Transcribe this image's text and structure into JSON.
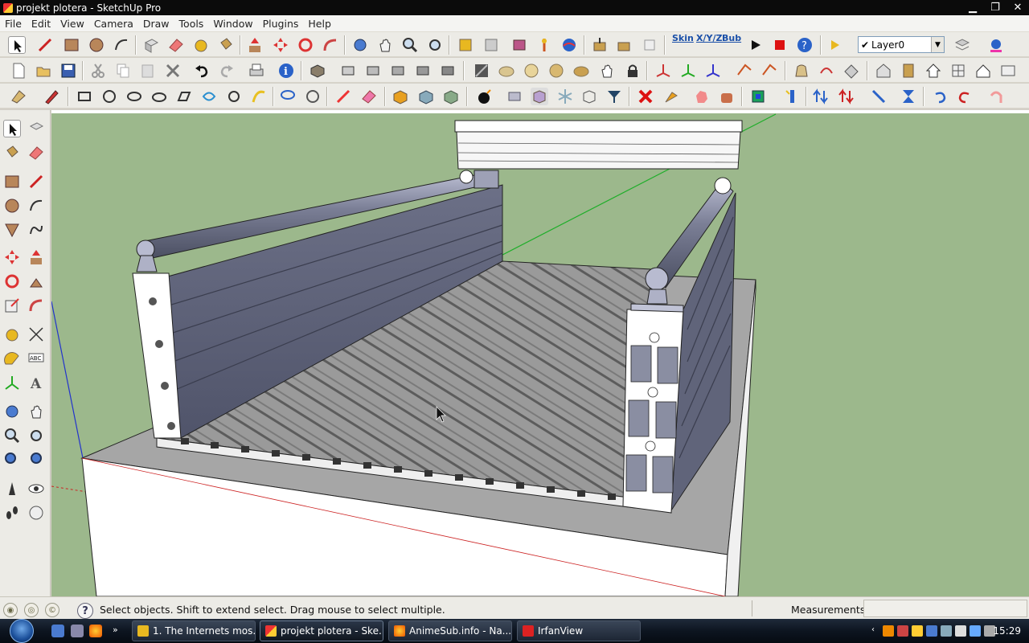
{
  "window": {
    "title": "projekt plotera - SketchUp Pro"
  },
  "menu": [
    "File",
    "Edit",
    "View",
    "Camera",
    "Draw",
    "Tools",
    "Window",
    "Plugins",
    "Help"
  ],
  "toolbar": {
    "skin_label": "Skin",
    "xyz_label": "X/Y/Z",
    "bub_label": "Bub",
    "layer_value": "Layer0",
    "layer_check": "✔"
  },
  "status": {
    "hint": "Select objects. Shift to extend select. Drag mouse to select multiple.",
    "measurements_label": "Measurements",
    "measurements_value": ""
  },
  "taskbar": {
    "tasks": [
      {
        "label": "1. The Internets mos..."
      },
      {
        "label": "projekt plotera - Ske..."
      },
      {
        "label": "AnimeSub.info - Na..."
      },
      {
        "label": "IrfanView"
      }
    ],
    "clock": "15:29",
    "overflow": "»"
  },
  "colors": {
    "sky": "#ffffff",
    "ground": "#9cb88c",
    "aluminium": "#5f6377",
    "base_top": "#a6a6a6"
  }
}
